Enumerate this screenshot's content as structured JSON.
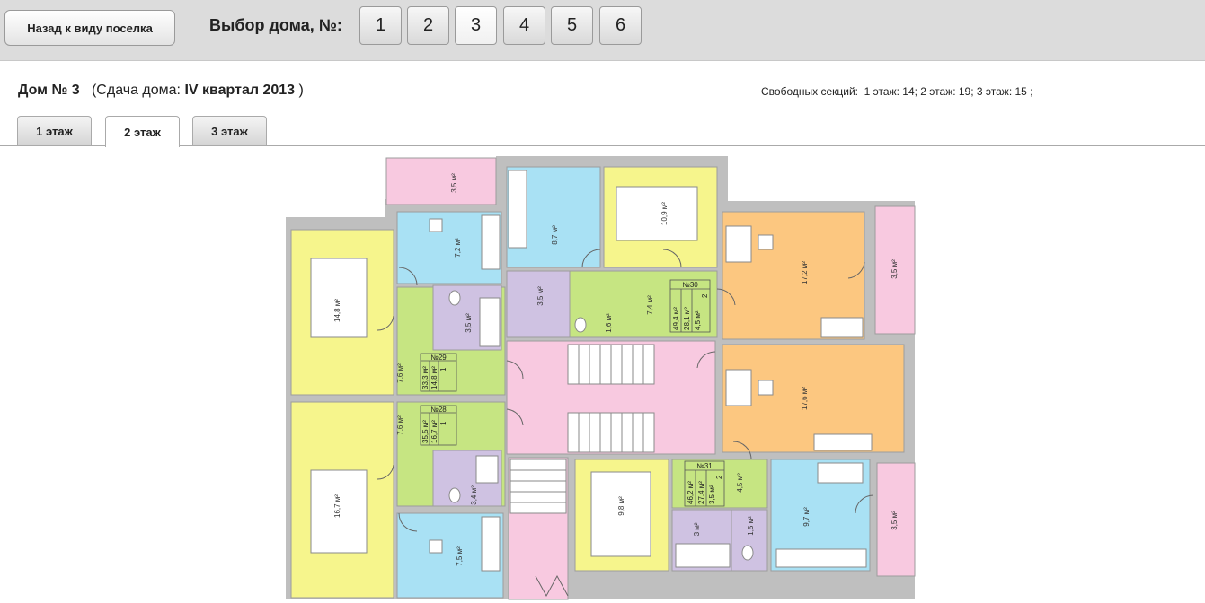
{
  "header": {
    "back_label": "Назад к виду поселка",
    "house_select_label": "Выбор дома, №:",
    "house_numbers": [
      "1",
      "2",
      "3",
      "4",
      "5",
      "6"
    ],
    "active_house": "3"
  },
  "info": {
    "house_prefix": "Дом № 3",
    "delivery_open": "(Сдача дома:",
    "delivery_value": "IV квартал 2013",
    "delivery_close": ")",
    "free_sections_label": "Свободных секций:",
    "free_sections_values": "1 этаж:  14; 2 этаж:  19; 3 этаж:  15 ;"
  },
  "tabs": [
    "1 этаж",
    "2 этаж",
    "3 этаж"
  ],
  "active_tab": "2 этаж",
  "plan": {
    "rooms": {
      "balcony_top_left": "3,5 м²",
      "kitchen_29": "7,2 м²",
      "kitchen_30": "8,7 м²",
      "bedroom_30": "10,9 м²",
      "living_30": "17,2 м²",
      "balcony_right_top": "3,5 м²",
      "bedroom_29": "14,8 м²",
      "bath_29": "3,5 м²",
      "bath_30": "3,5 м²",
      "wc_30": "1,6 м²",
      "hall_30": "7,4 м²",
      "hall_29": "7,6 м²",
      "hall_28": "7,6 м²",
      "living_31": "17,6 м²",
      "bedroom_28": "16,7 м²",
      "bath_28": "3,4 м²",
      "bedroom_31": "9,8 м²",
      "hall_31": "4,5 м²",
      "bath_31": "3 м²",
      "wc_31": "1,5 м²",
      "kitchen_31": "9,7 м²",
      "balcony_right_bottom": "3,5 м²",
      "kitchen_28": "7,5 м²"
    },
    "apartments": {
      "a29": {
        "num": "№29",
        "rooms": "1",
        "total": "33,3 м²",
        "living": "14,8 м²"
      },
      "a28": {
        "num": "№28",
        "rooms": "1",
        "total": "35,5 м²",
        "living": "16,7 м²"
      },
      "a30": {
        "num": "№30",
        "rooms": "2",
        "total": "49,4 м²",
        "living": "28,1 м²",
        "balcony": "4,5 м²"
      },
      "a31": {
        "num": "№31",
        "rooms": "2",
        "total": "46,2 м²",
        "living": "27,4 м²",
        "balcony": "3,5 м²"
      }
    }
  },
  "colors": {
    "topbar": "#dcdcdc",
    "yellow": "#f6f58c",
    "blue": "#a9e1f4",
    "pink": "#f8c9e0",
    "orange": "#fcc780",
    "green": "#c6e582",
    "purple": "#cfc2e2",
    "wall": "#bfbfbf"
  }
}
